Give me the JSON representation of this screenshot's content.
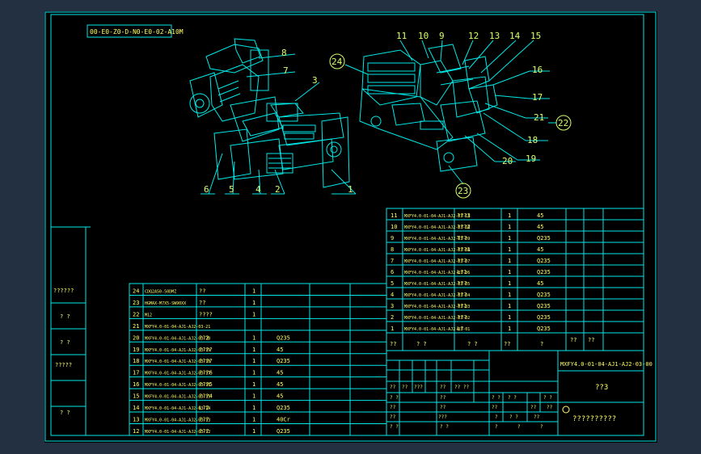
{
  "colors": {
    "viewport_bg": "#233042",
    "sheet_bg": "#000000",
    "line_color": "#00e8e8",
    "text_color": "#ffff66",
    "callout_color": "#d8ff6a"
  },
  "drawing": {
    "code_box": "00-E0-Z0-D-N0-E0-02-A10M",
    "callouts": {
      "c1": "1",
      "c2": "2",
      "c3": "3",
      "c4": "4",
      "c5": "5",
      "c6": "6",
      "c7": "7",
      "c8": "8",
      "c9": "9",
      "c10": "10",
      "c11": "11",
      "c12": "12",
      "c13": "13",
      "c14": "14",
      "c15": "15",
      "c16": "16",
      "c17": "17",
      "c18": "18",
      "c19": "19",
      "c20": "20",
      "c21": "21",
      "c22": "22",
      "c23": "23",
      "c24": "24"
    }
  },
  "left_column": [
    "??????",
    "? ?",
    "? ?",
    "?????",
    "? ?"
  ],
  "bom_left": [
    {
      "no": "24",
      "code": "CDQ2A50-50DMZ",
      "name": "??",
      "qty": "1",
      "mat": ""
    },
    {
      "no": "23",
      "code": "HGMAX-M7X5-SW90XX",
      "name": "??",
      "qty": "1",
      "mat": ""
    },
    {
      "no": "22",
      "code": "M12",
      "name": "????",
      "qty": "1",
      "mat": ""
    },
    {
      "no": "21",
      "code": "MXFY4.0-01-04-AJ1-AJ2-03-21",
      "name": "",
      "qty": "",
      "mat": ""
    },
    {
      "no": "20",
      "code": "MXFY4.0-01-04-AJ1-AJ2-03-20",
      "name": "??2",
      "qty": "1",
      "mat": "Q235"
    },
    {
      "no": "19",
      "code": "MXFY4.0-01-04-AJ1-AJ2-03-19",
      "name": "????",
      "qty": "1",
      "mat": "45"
    },
    {
      "no": "18",
      "code": "MXFY4.0-01-04-AJ1-AJ2-03-18",
      "name": "????",
      "qty": "1",
      "mat": "Q235"
    },
    {
      "no": "17",
      "code": "MXFY4.0-01-04-AJ1-AJ2-03-17",
      "name": "???6",
      "qty": "1",
      "mat": "45"
    },
    {
      "no": "16",
      "code": "MXFY4.0-01-04-AJ1-AJ2-03-16",
      "name": "???5",
      "qty": "1",
      "mat": "45"
    },
    {
      "no": "15",
      "code": "MXFY4.0-01-04-AJ1-AJ2-03-15",
      "name": "???4",
      "qty": "1",
      "mat": "45"
    },
    {
      "no": "14",
      "code": "MXFY4.0-01-04-AJ1-AJ2-03-14",
      "name": "L?2",
      "qty": "1",
      "mat": "Q235"
    },
    {
      "no": "13",
      "code": "MXFY4.0-01-04-AJ1-AJ2-03-13",
      "name": "???",
      "qty": "1",
      "mat": "40Cr"
    },
    {
      "no": "12",
      "code": "MXFY4.0-01-04-AJ1-AJ2-03-12",
      "name": "???",
      "qty": "1",
      "mat": "Q235"
    }
  ],
  "bom_right": [
    {
      "no": "11",
      "code": "MXFY4.0-01-04-AJ1-AJ2-03-11",
      "name": "???3",
      "qty": "1",
      "mat": "45"
    },
    {
      "no": "10",
      "code": "MXFY4.0-01-04-AJ1-AJ2-03-10",
      "name": "???2",
      "qty": "1",
      "mat": "45"
    },
    {
      "no": "9",
      "code": "MXFY4.0-01-04-AJ1-AJ2-03-09",
      "name": "T??",
      "qty": "1",
      "mat": "Q235"
    },
    {
      "no": "8",
      "code": "MXFY4.0-01-04-AJ1-AJ2-03-08",
      "name": "???1",
      "qty": "1",
      "mat": "45"
    },
    {
      "no": "7",
      "code": "MXFY4.0-01-04-AJ1-AJ2-03-07",
      "name": "???",
      "qty": "1",
      "mat": "Q235"
    },
    {
      "no": "6",
      "code": "MXFY4.0-01-04-AJ1-AJ2-03-06",
      "name": "L?1",
      "qty": "1",
      "mat": "Q235"
    },
    {
      "no": "5",
      "code": "MXFY4.0-01-04-AJ1-AJ2-03-05",
      "name": "???",
      "qty": "1",
      "mat": "45"
    },
    {
      "no": "4",
      "code": "MXFY4.0-01-04-AJ1-AJ2-03-04",
      "name": "???",
      "qty": "1",
      "mat": "Q235"
    },
    {
      "no": "3",
      "code": "MXFY4.0-01-04-AJ1-AJ2-03-03",
      "name": "??1",
      "qty": "1",
      "mat": "Q235"
    },
    {
      "no": "2",
      "code": "MXFY4.0-01-04-AJ1-AJ2-03-02",
      "name": "???",
      "qty": "1",
      "mat": "Q235"
    },
    {
      "no": "1",
      "code": "MXFY4.0-01-04-AJ1-AJ2-03-01",
      "name": "L?",
      "qty": "1",
      "mat": "Q235"
    }
  ],
  "bom_header": {
    "no": "??",
    "code": "? ?",
    "name": "? ?",
    "qty": "??",
    "mat": "?",
    "extra1": "??",
    "extra2": "??"
  },
  "title_block": {
    "drawing_no": "MXFY4.0-01-04-AJ1-AJ2-03-00",
    "part_name": "??3",
    "company": "??????????",
    "cells": {
      "a1": "??",
      "a2": "??",
      "a3": "???",
      "a4": "??",
      "a5": "?? ??",
      "b1": "? ?",
      "b2": "??",
      "b3": "? ?",
      "b4": "? ?",
      "b5": "? ?",
      "c1": "??",
      "c2": "??",
      "c3": "??",
      "c4": "??",
      "c5": "??",
      "d1": "???",
      "d2": "??",
      "d3": "?",
      "d4": "? ?",
      "d5": "??",
      "e1": "? ?",
      "e2": "? ?",
      "e3": "?",
      "e4": "?",
      "e5": "?"
    }
  }
}
